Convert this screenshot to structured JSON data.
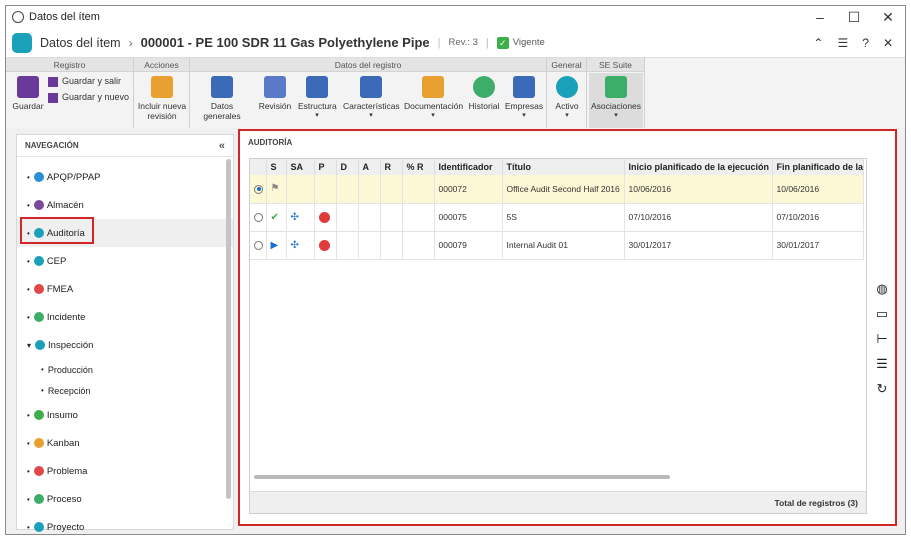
{
  "window": {
    "title": "Datos del ítem",
    "controls": [
      "–",
      "☐",
      "✕"
    ]
  },
  "header": {
    "section": "Datos del ítem",
    "item_title": "000001 - PE 100 SDR 11 Gas Polyethylene Pipe",
    "rev": "Rev.: 3",
    "status": "Vigente",
    "icons": [
      "collapse-icon",
      "list-icon",
      "help-icon",
      "close-icon"
    ]
  },
  "ribbon": {
    "groups": {
      "registro": "Registro",
      "acciones": "Acciones",
      "datos": "Datos del registro",
      "general": "General",
      "suite": "SE Suite"
    },
    "buttons": {
      "guardar": "Guardar",
      "guardar_salir": "Guardar y salir",
      "guardar_nuevo": "Guardar y nuevo",
      "incluir": "Incluir nueva revisión",
      "datos_generales": "Datos generales",
      "revision": "Revisión",
      "estructura": "Estructura",
      "caracteristicas": "Características",
      "documentacion": "Documentación",
      "historial": "Historial",
      "empresas": "Empresas",
      "activo": "Activo",
      "asociaciones": "Asociaciones"
    }
  },
  "nav": {
    "title": "NAVEGACIÓN",
    "collapse": "«",
    "items": [
      {
        "label": "APQP/PPAP",
        "color": "#2a8fd6"
      },
      {
        "label": "Almacén",
        "color": "#7a4a9a"
      },
      {
        "label": "Auditoría",
        "color": "#1aa0b8"
      },
      {
        "label": "CEP",
        "color": "#1aa0b8"
      },
      {
        "label": "FMEA",
        "color": "#e04848"
      },
      {
        "label": "Incidente",
        "color": "#3cae6a"
      },
      {
        "label": "Inspección",
        "color": "#1aa0b8"
      },
      {
        "label": "Producción",
        "color": ""
      },
      {
        "label": "Recepción",
        "color": ""
      },
      {
        "label": "Insumo",
        "color": "#3cae4a"
      },
      {
        "label": "Kanban",
        "color": "#e8a030"
      },
      {
        "label": "Problema",
        "color": "#e04848"
      },
      {
        "label": "Proceso",
        "color": "#3cae6a"
      },
      {
        "label": "Proyecto",
        "color": "#1aa0b8"
      }
    ]
  },
  "audit": {
    "title": "AUDITORÍA",
    "columns": [
      "S",
      "SA",
      "P",
      "D",
      "A",
      "R",
      "% R",
      "Identificador",
      "Título",
      "Inicio planificado de la ejecución",
      "Fin planificado de la"
    ],
    "rows": [
      {
        "id": "000072",
        "title": "Office Audit Second Half 2016",
        "start": "10/06/2016",
        "end": "10/06/2016"
      },
      {
        "id": "000075",
        "title": "5S",
        "start": "07/10/2016",
        "end": "07/10/2016"
      },
      {
        "id": "000079",
        "title": "Internal Audit 01",
        "start": "30/01/2017",
        "end": "30/01/2017"
      }
    ],
    "footer": "Total de registros (3)"
  }
}
